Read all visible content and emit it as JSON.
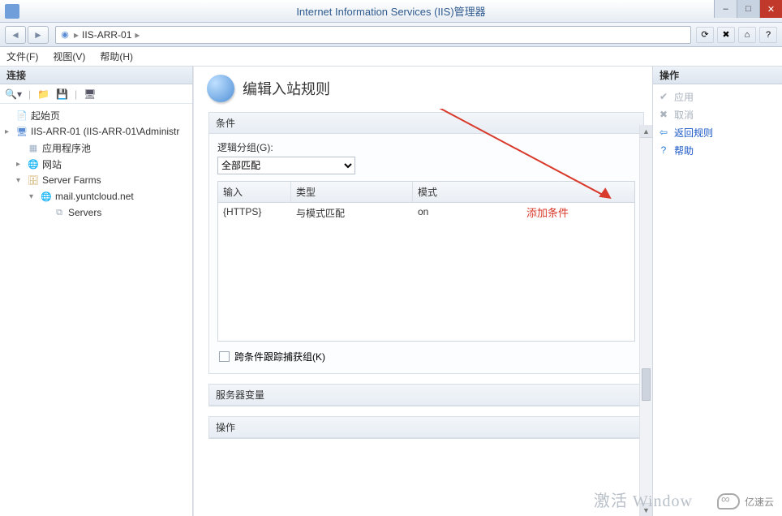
{
  "window": {
    "title": "Internet Information Services (IIS)管理器",
    "breadcrumb_host": "IIS-ARR-01"
  },
  "menus": {
    "file": "文件(F)",
    "view": "视图(V)",
    "help": "帮助(H)"
  },
  "left": {
    "header": "连接",
    "tree": {
      "start": "起始页",
      "server": "IIS-ARR-01 (IIS-ARR-01\\Administr",
      "app_pools": "应用程序池",
      "sites": "网站",
      "farms": "Server Farms",
      "farm_domain": "mail.yuntcloud.net",
      "servers": "Servers"
    }
  },
  "main": {
    "title": "编辑入站规则",
    "group_conditions": "条件",
    "logic_label": "逻辑分组(G):",
    "logic_value": "全部匹配",
    "cols": {
      "input": "输入",
      "type": "类型",
      "pattern": "模式"
    },
    "row1": {
      "input": "{HTTPS}",
      "type": "与模式匹配",
      "pattern": "on"
    },
    "track_label": "跨条件跟踪捕获组(K)",
    "group_server_vars": "服务器变量",
    "group_action": "操作",
    "annotation": "添加条件"
  },
  "right": {
    "header": "操作",
    "apply": "应用",
    "cancel": "取消",
    "back": "返回规则",
    "help": "帮助"
  },
  "watermark": "激活 Window",
  "brand": "亿速云"
}
